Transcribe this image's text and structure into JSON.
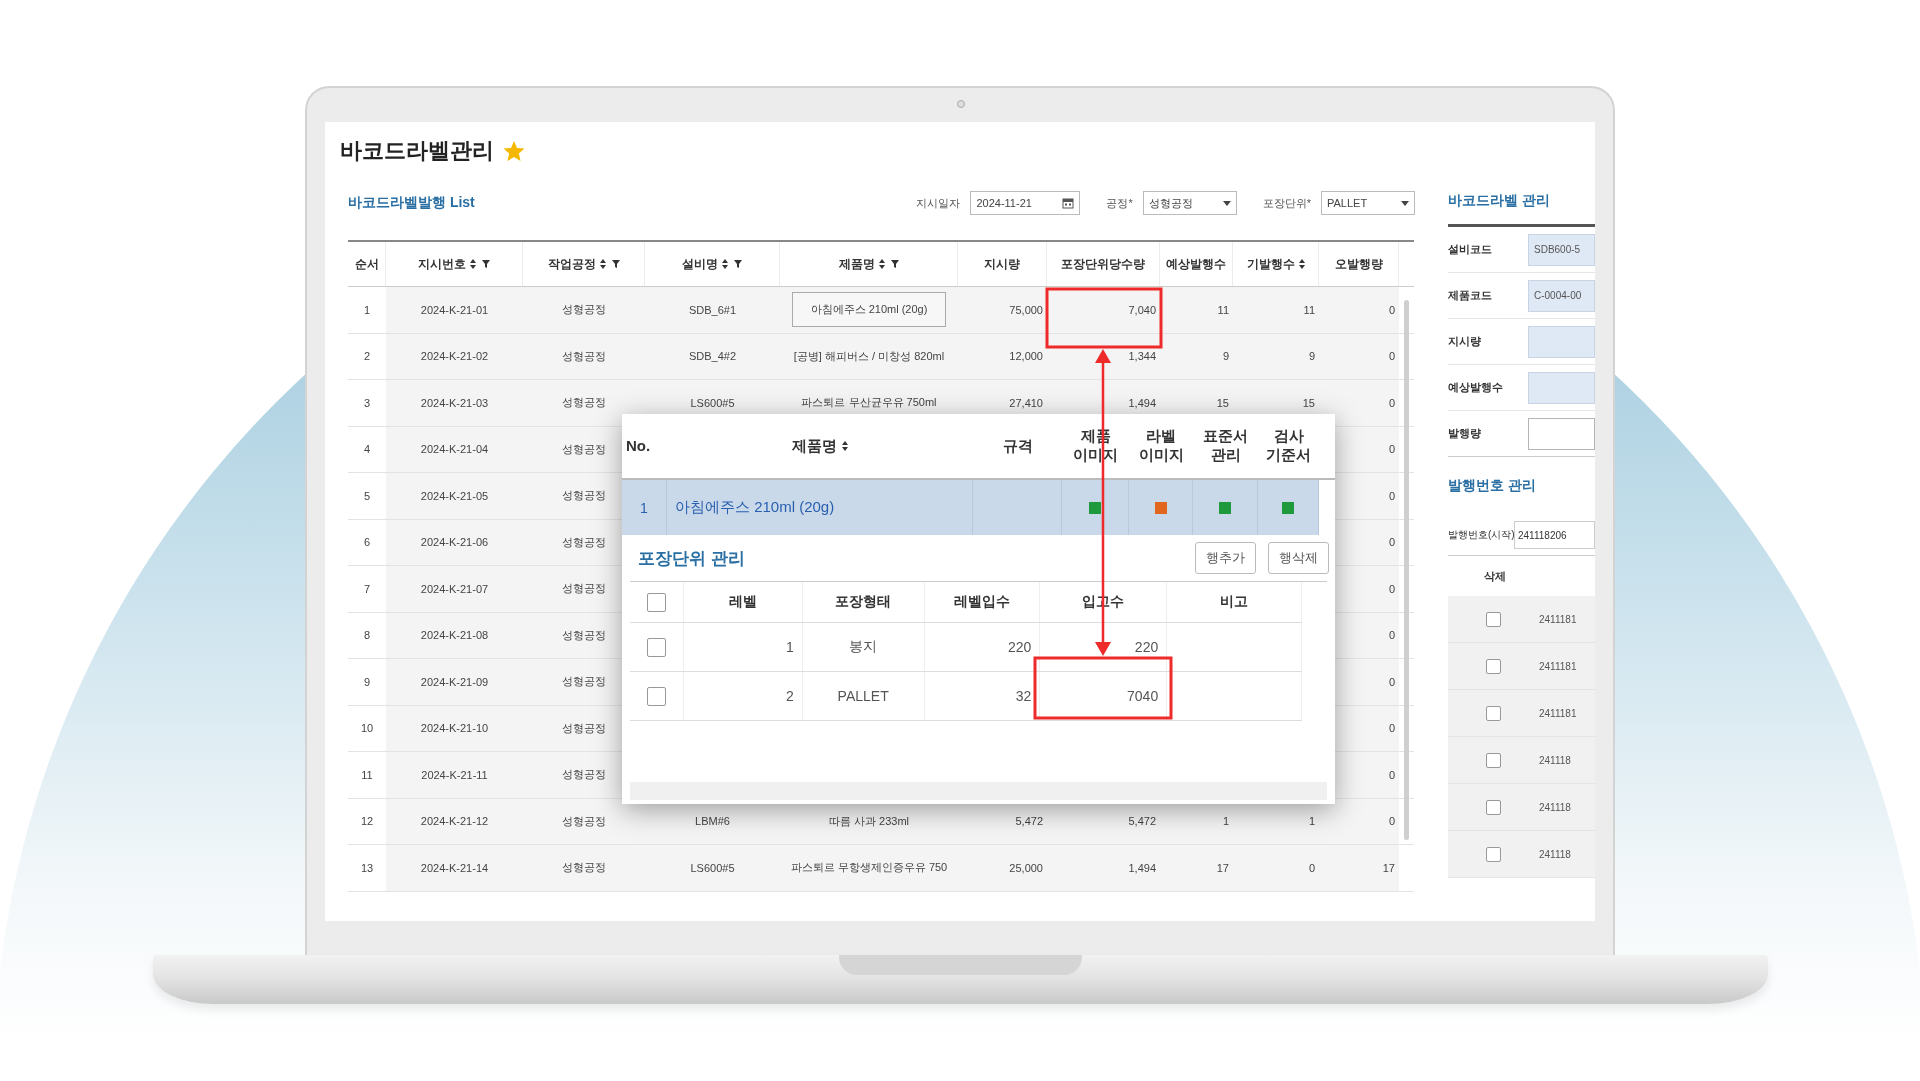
{
  "page": {
    "title": "바코드라벨관리",
    "favorite": true
  },
  "list_panel": {
    "title": "바코드라벨발행 List",
    "filters": [
      {
        "label": "지시일자",
        "kind": "date",
        "value": "2024-11-21"
      },
      {
        "label": "공정*",
        "kind": "select",
        "value": "성형공정"
      },
      {
        "label": "포장단위*",
        "kind": "select",
        "value": "PALLET"
      }
    ]
  },
  "table": {
    "columns": [
      {
        "label": "순서",
        "sort": false,
        "filter": false,
        "numeric": false
      },
      {
        "label": "지시번호",
        "sort": true,
        "filter": true,
        "numeric": false
      },
      {
        "label": "작업공정",
        "sort": true,
        "filter": true,
        "numeric": false
      },
      {
        "label": "설비명",
        "sort": true,
        "filter": true,
        "numeric": false
      },
      {
        "label": "제품명",
        "sort": true,
        "filter": true,
        "numeric": false
      },
      {
        "label": "지시량",
        "sort": false,
        "filter": false,
        "numeric": true
      },
      {
        "label": "포장단위당수량",
        "sort": false,
        "filter": false,
        "numeric": true
      },
      {
        "label": "예상발행수",
        "sort": false,
        "filter": false,
        "numeric": true
      },
      {
        "label": "기발행수",
        "sort": true,
        "filter": false,
        "numeric": true
      },
      {
        "label": "오발행량",
        "sort": false,
        "filter": false,
        "numeric": true
      }
    ],
    "rows": [
      {
        "product_focused": true,
        "cells": [
          "1",
          "2024-K-21-01",
          "성형공정",
          "SDB_6#1",
          "아침에주스 210ml (20g)",
          "75,000",
          "7,040",
          "11",
          "11",
          "0"
        ]
      },
      {
        "product_focused": false,
        "cells": [
          "2",
          "2024-K-21-02",
          "성형공정",
          "SDB_4#2",
          "[공병] 해피버스 / 미창성 820ml",
          "12,000",
          "1,344",
          "9",
          "9",
          "0"
        ]
      },
      {
        "product_focused": false,
        "cells": [
          "3",
          "2024-K-21-03",
          "성형공정",
          "LS600#5",
          "파스퇴르 무산균우유 750ml",
          "27,410",
          "1,494",
          "15",
          "15",
          "0"
        ]
      },
      {
        "cells": [
          "4",
          "2024-K-21-04",
          "성형공정",
          null,
          null,
          null,
          null,
          null,
          null,
          "0"
        ]
      },
      {
        "cells": [
          "5",
          "2024-K-21-05",
          "성형공정",
          null,
          null,
          null,
          null,
          null,
          null,
          "0"
        ]
      },
      {
        "cells": [
          "6",
          "2024-K-21-06",
          "성형공정",
          null,
          null,
          null,
          null,
          null,
          null,
          "0"
        ]
      },
      {
        "cells": [
          "7",
          "2024-K-21-07",
          "성형공정",
          null,
          null,
          null,
          null,
          null,
          null,
          "0"
        ]
      },
      {
        "cells": [
          "8",
          "2024-K-21-08",
          "성형공정",
          null,
          null,
          null,
          null,
          null,
          null,
          "0"
        ]
      },
      {
        "cells": [
          "9",
          "2024-K-21-09",
          "성형공정",
          null,
          null,
          null,
          null,
          null,
          null,
          "0"
        ]
      },
      {
        "cells": [
          "10",
          "2024-K-21-10",
          "성형공정",
          null,
          null,
          null,
          null,
          null,
          null,
          "0"
        ]
      },
      {
        "cells": [
          "11",
          "2024-K-21-11",
          "성형공정",
          null,
          null,
          null,
          null,
          null,
          null,
          "0"
        ]
      },
      {
        "product_focused": false,
        "cells": [
          "12",
          "2024-K-21-12",
          "성형공정",
          "LBM#6",
          "따름 사과 233ml",
          "5,472",
          "5,472",
          "1",
          "1",
          "0"
        ]
      },
      {
        "product_focused": false,
        "cells": [
          "13",
          "2024-K-21-14",
          "성형공정",
          "LS600#5",
          "파스퇴르 무항생제인증우유 750",
          "25,000",
          "1,494",
          "17",
          "0",
          "17"
        ]
      }
    ]
  },
  "popup": {
    "columns": [
      "No.",
      "제품명",
      "규격",
      "제품 이미지",
      "라벨 이미지",
      "표준서 관리",
      "검사 기준서"
    ],
    "rows": [
      {
        "no": "1",
        "product": "아침에주스 210ml (20g)",
        "selected": true,
        "docs": [
          {
            "color": "#1e9a3c"
          },
          {
            "color": "#e0661e"
          },
          {
            "color": "#1e9a3c"
          },
          {
            "color": "#1e9a3c"
          }
        ]
      }
    ],
    "section_title": "포장단위 관리",
    "buttons": [
      "행추가",
      "행삭제"
    ],
    "unit_table": {
      "all_checked": false,
      "columns": [
        "레벨",
        "포장형태",
        "레벨입수",
        "입고수",
        "비고"
      ],
      "rows": [
        {
          "checked": false,
          "level": "1",
          "type": "봉지",
          "per_level": "220",
          "received": "220"
        },
        {
          "checked": false,
          "level": "2",
          "type": "PALLET",
          "per_level": "32",
          "received": "7040"
        }
      ]
    }
  },
  "right_panel": {
    "title": "바코드라벨 관리",
    "fields": [
      {
        "label": "설비코드",
        "value": "SDB600-5",
        "readonly": true
      },
      {
        "label": "제품코드",
        "value": "C-0004-00",
        "readonly": true
      },
      {
        "label": "지시량",
        "readonly": true
      },
      {
        "label": "예상발행수",
        "readonly": true
      },
      {
        "label": "발행량",
        "readonly": false
      }
    ],
    "issue_title": "발행번호 관리",
    "start_field": {
      "label": "발행번호(시작)",
      "value": "241118206"
    },
    "issue_table": {
      "column": "삭제",
      "rows": [
        {
          "checked": false,
          "number": "2411181"
        },
        {
          "checked": false,
          "number": "2411181"
        },
        {
          "checked": false,
          "number": "2411181"
        },
        {
          "checked": false,
          "number": "241118"
        },
        {
          "checked": false,
          "number": "241118"
        },
        {
          "checked": false,
          "number": "241118"
        }
      ]
    }
  }
}
